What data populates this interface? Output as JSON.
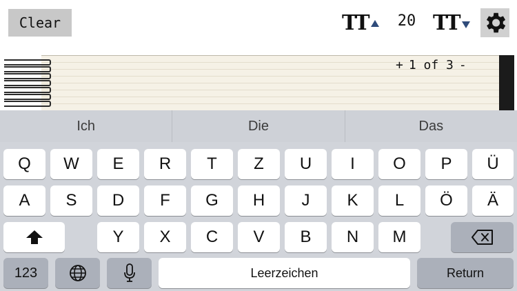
{
  "toolbar": {
    "clear_label": "Clear",
    "font_increase_glyph": "TT",
    "font_size": "20",
    "font_decrease_glyph": "TT"
  },
  "notepad": {
    "page_prev": "+",
    "page_indicator": "1 of 3",
    "page_next": "-"
  },
  "keyboard": {
    "suggestions": [
      "Ich",
      "Die",
      "Das"
    ],
    "row1": [
      "Q",
      "W",
      "E",
      "R",
      "T",
      "Z",
      "U",
      "I",
      "O",
      "P",
      "Ü"
    ],
    "row2": [
      "A",
      "S",
      "D",
      "F",
      "G",
      "H",
      "J",
      "K",
      "L",
      "Ö",
      "Ä"
    ],
    "row3": [
      "Y",
      "X",
      "C",
      "V",
      "B",
      "N",
      "M"
    ],
    "numbers_label": "123",
    "space_label": "Leerzeichen",
    "return_label": "Return"
  },
  "colors": {
    "accent_triangle": "#2f4b7a",
    "keyboard_bg": "#d1d4da",
    "function_key": "#abb0ba"
  }
}
